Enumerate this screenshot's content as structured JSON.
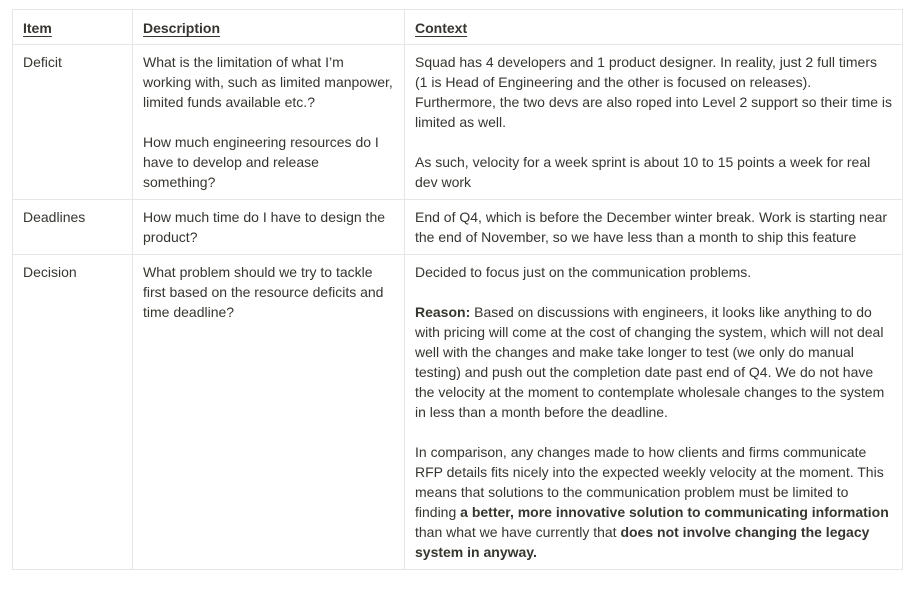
{
  "table": {
    "headers": [
      "Item",
      "Description",
      "Context"
    ],
    "rows": [
      {
        "item": "Deficit",
        "description": [
          "What is the limitation of what I’m working with, such as limited manpower, limited funds available etc.?",
          "How much engineering resources do I have to develop and release something?"
        ],
        "context": [
          "Squad has 4 developers and 1 product designer. In reality, just 2 full timers (1 is Head of Engineering and the other is focused on releases). Furthermore, the two devs are also roped into Level 2 support so their time is limited as well.",
          "As such, velocity for a week sprint is about 10 to 15 points a week for real dev work"
        ]
      },
      {
        "item": "Deadlines",
        "description": [
          "How much time do I have to design the product?"
        ],
        "context": [
          "End of Q4, which is before the December winter break. Work is starting near the end of November, so we have less than a month to ship this feature"
        ]
      },
      {
        "item": "Decision",
        "description": [
          "What problem should we try to tackle first based on the resource deficits and time deadline?"
        ],
        "context_intro": "Decided to focus just on the communication problems.",
        "reason_label": "Reason:",
        "reason_text": " Based on discussions with engineers, it looks like anything to do with pricing will come at the cost of changing the system, which will not deal well with the changes and make take longer to test (we only do manual testing) and push out the completion date past end of Q4. We do not have the velocity at the moment to contemplate wholesale changes to the system in less than a month before the deadline.",
        "comparison": {
          "text1": "In comparison, any changes made to how clients and firms communicate RFP details fits nicely into the expected weekly velocity at the moment. This means that solutions to the communication problem must be limited to finding ",
          "bold1": "a better, more innovative solution to communicating information",
          "text2": " than what we have currently that ",
          "bold2": "does not involve changing the legacy system in anyway."
        }
      }
    ]
  }
}
